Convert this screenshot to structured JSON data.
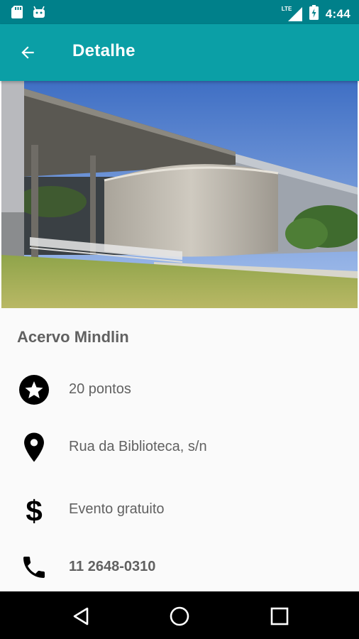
{
  "status_bar": {
    "time": "4:44",
    "network_label": "LTE",
    "icons": [
      "sd-card-icon",
      "android-icon",
      "lte-signal-icon",
      "battery-charging-icon"
    ]
  },
  "app_bar": {
    "title": "Detalhe",
    "back_icon": "arrow-left-icon"
  },
  "hero_image": {
    "description_icon": "building-photo"
  },
  "place": {
    "name": "Acervo Mindlin"
  },
  "details": [
    {
      "icon": "star-circle-icon",
      "text": "20 pontos"
    },
    {
      "icon": "location-pin-icon",
      "text": "Rua da Biblioteca, s/n"
    },
    {
      "icon": "dollar-icon",
      "text": "Evento gratuito"
    },
    {
      "icon": "phone-icon",
      "text": "11 2648-0310"
    }
  ],
  "nav_bar": {
    "buttons": [
      "back-triangle-icon",
      "home-circle-icon",
      "recents-square-icon"
    ]
  },
  "colors": {
    "status_bar": "#00808a",
    "app_bar": "#0b9fa6",
    "background": "#fafafa",
    "text": "#616161"
  }
}
